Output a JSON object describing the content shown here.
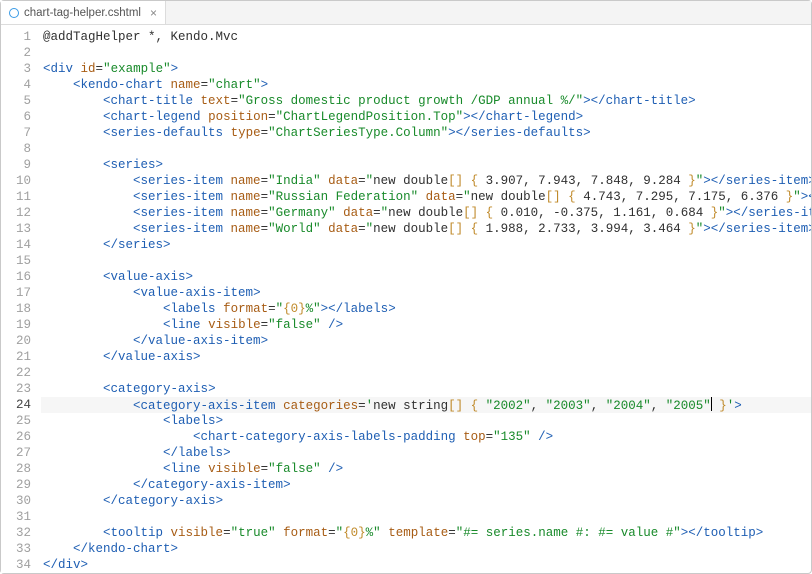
{
  "tab": {
    "filename": "chart-tag-helper.cshtml",
    "close": "×"
  },
  "lines": [
    {
      "n": 1,
      "segs": [
        [
          "t-dark",
          "@addTagHelper *, Kendo.Mvc"
        ]
      ]
    },
    {
      "n": 2,
      "segs": [
        [
          "",
          "&nbsp;"
        ]
      ]
    },
    {
      "n": 3,
      "segs": [
        [
          "t-pun",
          "&lt;"
        ],
        [
          "t-tag",
          "div "
        ],
        [
          "t-attr",
          "id"
        ],
        [
          "t-eq",
          "="
        ],
        [
          "t-str",
          "\"example\""
        ],
        [
          "t-pun",
          "&gt;"
        ]
      ]
    },
    {
      "n": 4,
      "segs": [
        [
          "",
          "    "
        ],
        [
          "t-pun",
          "&lt;"
        ],
        [
          "t-tag",
          "kendo-chart "
        ],
        [
          "t-attr",
          "name"
        ],
        [
          "t-eq",
          "="
        ],
        [
          "t-str",
          "\"chart\""
        ],
        [
          "t-pun",
          "&gt;"
        ]
      ]
    },
    {
      "n": 5,
      "segs": [
        [
          "",
          "        "
        ],
        [
          "t-pun",
          "&lt;"
        ],
        [
          "t-tag",
          "chart-title "
        ],
        [
          "t-attr",
          "text"
        ],
        [
          "t-eq",
          "="
        ],
        [
          "t-str",
          "\"Gross domestic product growth /GDP annual %/\""
        ],
        [
          "t-pun",
          "&gt;&lt;/"
        ],
        [
          "t-tag",
          "chart-title"
        ],
        [
          "t-pun",
          "&gt;"
        ]
      ]
    },
    {
      "n": 6,
      "segs": [
        [
          "",
          "        "
        ],
        [
          "t-pun",
          "&lt;"
        ],
        [
          "t-tag",
          "chart-legend "
        ],
        [
          "t-attr",
          "position"
        ],
        [
          "t-eq",
          "="
        ],
        [
          "t-str",
          "\"ChartLegendPosition.Top\""
        ],
        [
          "t-pun",
          "&gt;&lt;/"
        ],
        [
          "t-tag",
          "chart-legend"
        ],
        [
          "t-pun",
          "&gt;"
        ]
      ]
    },
    {
      "n": 7,
      "segs": [
        [
          "",
          "        "
        ],
        [
          "t-pun",
          "&lt;"
        ],
        [
          "t-tag",
          "series-defaults "
        ],
        [
          "t-attr",
          "type"
        ],
        [
          "t-eq",
          "="
        ],
        [
          "t-str",
          "\"ChartSeriesType.Column\""
        ],
        [
          "t-pun",
          "&gt;&lt;/"
        ],
        [
          "t-tag",
          "series-defaults"
        ],
        [
          "t-pun",
          "&gt;"
        ]
      ]
    },
    {
      "n": 8,
      "segs": [
        [
          "",
          "&nbsp;"
        ]
      ]
    },
    {
      "n": 9,
      "segs": [
        [
          "",
          "        "
        ],
        [
          "t-pun",
          "&lt;"
        ],
        [
          "t-tag",
          "series"
        ],
        [
          "t-pun",
          "&gt;"
        ]
      ]
    },
    {
      "n": 10,
      "segs": [
        [
          "",
          "            "
        ],
        [
          "t-pun",
          "&lt;"
        ],
        [
          "t-tag",
          "series-item "
        ],
        [
          "t-attr",
          "name"
        ],
        [
          "t-eq",
          "="
        ],
        [
          "t-str",
          "\"India\""
        ],
        [
          "",
          ""
        ],
        [
          "t-attr",
          " data"
        ],
        [
          "t-eq",
          "="
        ],
        [
          "t-strq",
          "\""
        ],
        [
          "t-dark",
          "new double"
        ],
        [
          "t-gold",
          "[] { "
        ],
        [
          "t-dark",
          "3.907, 7.943, 7.848, 9.284"
        ],
        [
          "t-gold",
          " }"
        ],
        [
          "t-strq",
          "\""
        ],
        [
          "t-pun",
          "&gt;&lt;/"
        ],
        [
          "t-tag",
          "series-item"
        ],
        [
          "t-pun",
          "&gt;"
        ]
      ]
    },
    {
      "n": 11,
      "segs": [
        [
          "",
          "            "
        ],
        [
          "t-pun",
          "&lt;"
        ],
        [
          "t-tag",
          "series-item "
        ],
        [
          "t-attr",
          "name"
        ],
        [
          "t-eq",
          "="
        ],
        [
          "t-str",
          "\"Russian Federation\""
        ],
        [
          "t-attr",
          " data"
        ],
        [
          "t-eq",
          "="
        ],
        [
          "t-strq",
          "\""
        ],
        [
          "t-dark",
          "new double"
        ],
        [
          "t-gold",
          "[] { "
        ],
        [
          "t-dark",
          "4.743, 7.295, 7.175, 6.376"
        ],
        [
          "t-gold",
          " }"
        ],
        [
          "t-strq",
          "\""
        ],
        [
          "t-pun",
          "&gt;&lt;/"
        ],
        [
          "t-tag",
          "series-item"
        ],
        [
          "t-pun",
          "&gt;"
        ]
      ]
    },
    {
      "n": 12,
      "segs": [
        [
          "",
          "            "
        ],
        [
          "t-pun",
          "&lt;"
        ],
        [
          "t-tag",
          "series-item "
        ],
        [
          "t-attr",
          "name"
        ],
        [
          "t-eq",
          "="
        ],
        [
          "t-str",
          "\"Germany\""
        ],
        [
          "t-attr",
          " data"
        ],
        [
          "t-eq",
          "="
        ],
        [
          "t-strq",
          "\""
        ],
        [
          "t-dark",
          "new double"
        ],
        [
          "t-gold",
          "[] { "
        ],
        [
          "t-dark",
          "0.010, -0.375, 1.161, 0.684"
        ],
        [
          "t-gold",
          " }"
        ],
        [
          "t-strq",
          "\""
        ],
        [
          "t-pun",
          "&gt;&lt;/"
        ],
        [
          "t-tag",
          "series-item"
        ],
        [
          "t-pun",
          "&gt;"
        ]
      ]
    },
    {
      "n": 13,
      "segs": [
        [
          "",
          "            "
        ],
        [
          "t-pun",
          "&lt;"
        ],
        [
          "t-tag",
          "series-item "
        ],
        [
          "t-attr",
          "name"
        ],
        [
          "t-eq",
          "="
        ],
        [
          "t-str",
          "\"World\""
        ],
        [
          "t-attr",
          " data"
        ],
        [
          "t-eq",
          "="
        ],
        [
          "t-strq",
          "\""
        ],
        [
          "t-dark",
          "new double"
        ],
        [
          "t-gold",
          "[] { "
        ],
        [
          "t-dark",
          "1.988, 2.733, 3.994, 3.464"
        ],
        [
          "t-gold",
          " }"
        ],
        [
          "t-strq",
          "\""
        ],
        [
          "t-pun",
          "&gt;&lt;/"
        ],
        [
          "t-tag",
          "series-item"
        ],
        [
          "t-pun",
          "&gt;"
        ]
      ]
    },
    {
      "n": 14,
      "segs": [
        [
          "",
          "        "
        ],
        [
          "t-pun",
          "&lt;/"
        ],
        [
          "t-tag",
          "series"
        ],
        [
          "t-pun",
          "&gt;"
        ]
      ]
    },
    {
      "n": 15,
      "segs": [
        [
          "",
          "&nbsp;"
        ]
      ]
    },
    {
      "n": 16,
      "segs": [
        [
          "",
          "        "
        ],
        [
          "t-pun",
          "&lt;"
        ],
        [
          "t-tag",
          "value-axis"
        ],
        [
          "t-pun",
          "&gt;"
        ]
      ]
    },
    {
      "n": 17,
      "segs": [
        [
          "",
          "            "
        ],
        [
          "t-pun",
          "&lt;"
        ],
        [
          "t-tag",
          "value-axis-item"
        ],
        [
          "t-pun",
          "&gt;"
        ]
      ]
    },
    {
      "n": 18,
      "segs": [
        [
          "",
          "                "
        ],
        [
          "t-pun",
          "&lt;"
        ],
        [
          "t-tag",
          "labels "
        ],
        [
          "t-attr",
          "format"
        ],
        [
          "t-eq",
          "="
        ],
        [
          "t-strq",
          "\""
        ],
        [
          "t-gold",
          "{0}"
        ],
        [
          "t-str",
          "%"
        ],
        [
          "t-strq",
          "\""
        ],
        [
          "t-pun",
          "&gt;&lt;/"
        ],
        [
          "t-tag",
          "labels"
        ],
        [
          "t-pun",
          "&gt;"
        ]
      ]
    },
    {
      "n": 19,
      "segs": [
        [
          "",
          "                "
        ],
        [
          "t-pun",
          "&lt;"
        ],
        [
          "t-tag",
          "line "
        ],
        [
          "t-attr",
          "visible"
        ],
        [
          "t-eq",
          "="
        ],
        [
          "t-str",
          "\"false\""
        ],
        [
          "t-pun",
          " /&gt;"
        ]
      ]
    },
    {
      "n": 20,
      "segs": [
        [
          "",
          "            "
        ],
        [
          "t-pun",
          "&lt;/"
        ],
        [
          "t-tag",
          "value-axis-item"
        ],
        [
          "t-pun",
          "&gt;"
        ]
      ]
    },
    {
      "n": 21,
      "segs": [
        [
          "",
          "        "
        ],
        [
          "t-pun",
          "&lt;/"
        ],
        [
          "t-tag",
          "value-axis"
        ],
        [
          "t-pun",
          "&gt;"
        ]
      ]
    },
    {
      "n": 22,
      "segs": [
        [
          "",
          "&nbsp;"
        ]
      ]
    },
    {
      "n": 23,
      "segs": [
        [
          "",
          "        "
        ],
        [
          "t-pun",
          "&lt;"
        ],
        [
          "t-tag",
          "category-axis"
        ],
        [
          "t-pun",
          "&gt;"
        ]
      ]
    },
    {
      "n": 24,
      "hl": true,
      "segs": [
        [
          "",
          "            "
        ],
        [
          "t-pun",
          "&lt;"
        ],
        [
          "t-tag",
          "category-axis-item "
        ],
        [
          "t-attr",
          "categories"
        ],
        [
          "t-eq",
          "="
        ],
        [
          "t-strq",
          "'"
        ],
        [
          "t-dark",
          "new string"
        ],
        [
          "t-gold",
          "[] { "
        ],
        [
          "t-str",
          "\"2002\""
        ],
        [
          "t-dark",
          ", "
        ],
        [
          "t-str",
          "\"2003\""
        ],
        [
          "t-dark",
          ", "
        ],
        [
          "t-str",
          "\"2004\""
        ],
        [
          "t-dark",
          ", "
        ],
        [
          "t-str",
          "\"2005\""
        ],
        [
          "",
          "<span class=\"cursor\"></span>"
        ],
        [
          "t-gold",
          " }"
        ],
        [
          "t-strq",
          "'"
        ],
        [
          "t-pun",
          "&gt;"
        ]
      ]
    },
    {
      "n": 25,
      "segs": [
        [
          "",
          "                "
        ],
        [
          "t-pun",
          "&lt;"
        ],
        [
          "t-tag",
          "labels"
        ],
        [
          "t-pun",
          "&gt;"
        ]
      ]
    },
    {
      "n": 26,
      "segs": [
        [
          "",
          "                    "
        ],
        [
          "t-pun",
          "&lt;"
        ],
        [
          "t-tag",
          "chart-category-axis-labels-padding "
        ],
        [
          "t-attr",
          "top"
        ],
        [
          "t-eq",
          "="
        ],
        [
          "t-str",
          "\"135\""
        ],
        [
          "t-pun",
          " /&gt;"
        ]
      ]
    },
    {
      "n": 27,
      "segs": [
        [
          "",
          "                "
        ],
        [
          "t-pun",
          "&lt;/"
        ],
        [
          "t-tag",
          "labels"
        ],
        [
          "t-pun",
          "&gt;"
        ]
      ]
    },
    {
      "n": 28,
      "segs": [
        [
          "",
          "                "
        ],
        [
          "t-pun",
          "&lt;"
        ],
        [
          "t-tag",
          "line "
        ],
        [
          "t-attr",
          "visible"
        ],
        [
          "t-eq",
          "="
        ],
        [
          "t-str",
          "\"false\""
        ],
        [
          "t-pun",
          " /&gt;"
        ]
      ]
    },
    {
      "n": 29,
      "segs": [
        [
          "",
          "            "
        ],
        [
          "t-pun",
          "&lt;/"
        ],
        [
          "t-tag",
          "category-axis-item"
        ],
        [
          "t-pun",
          "&gt;"
        ]
      ]
    },
    {
      "n": 30,
      "segs": [
        [
          "",
          "        "
        ],
        [
          "t-pun",
          "&lt;/"
        ],
        [
          "t-tag",
          "category-axis"
        ],
        [
          "t-pun",
          "&gt;"
        ]
      ]
    },
    {
      "n": 31,
      "segs": [
        [
          "",
          "&nbsp;"
        ]
      ]
    },
    {
      "n": 32,
      "segs": [
        [
          "",
          "        "
        ],
        [
          "t-pun",
          "&lt;"
        ],
        [
          "t-tag",
          "tooltip "
        ],
        [
          "t-attr",
          "visible"
        ],
        [
          "t-eq",
          "="
        ],
        [
          "t-str",
          "\"true\""
        ],
        [
          "t-attr",
          " format"
        ],
        [
          "t-eq",
          "="
        ],
        [
          "t-strq",
          "\""
        ],
        [
          "t-gold",
          "{0}"
        ],
        [
          "t-str",
          "%"
        ],
        [
          "t-strq",
          "\""
        ],
        [
          "t-attr",
          " template"
        ],
        [
          "t-eq",
          "="
        ],
        [
          "t-str",
          "\"#= series.name #: #= value #\""
        ],
        [
          "t-pun",
          "&gt;&lt;/"
        ],
        [
          "t-tag",
          "tooltip"
        ],
        [
          "t-pun",
          "&gt;"
        ]
      ]
    },
    {
      "n": 33,
      "segs": [
        [
          "",
          "    "
        ],
        [
          "t-pun",
          "&lt;/"
        ],
        [
          "t-tag",
          "kendo-chart"
        ],
        [
          "t-pun",
          "&gt;"
        ]
      ]
    },
    {
      "n": 34,
      "segs": [
        [
          "t-pun",
          "&lt;/"
        ],
        [
          "t-tag",
          "div"
        ],
        [
          "t-pun",
          "&gt;"
        ]
      ]
    }
  ]
}
